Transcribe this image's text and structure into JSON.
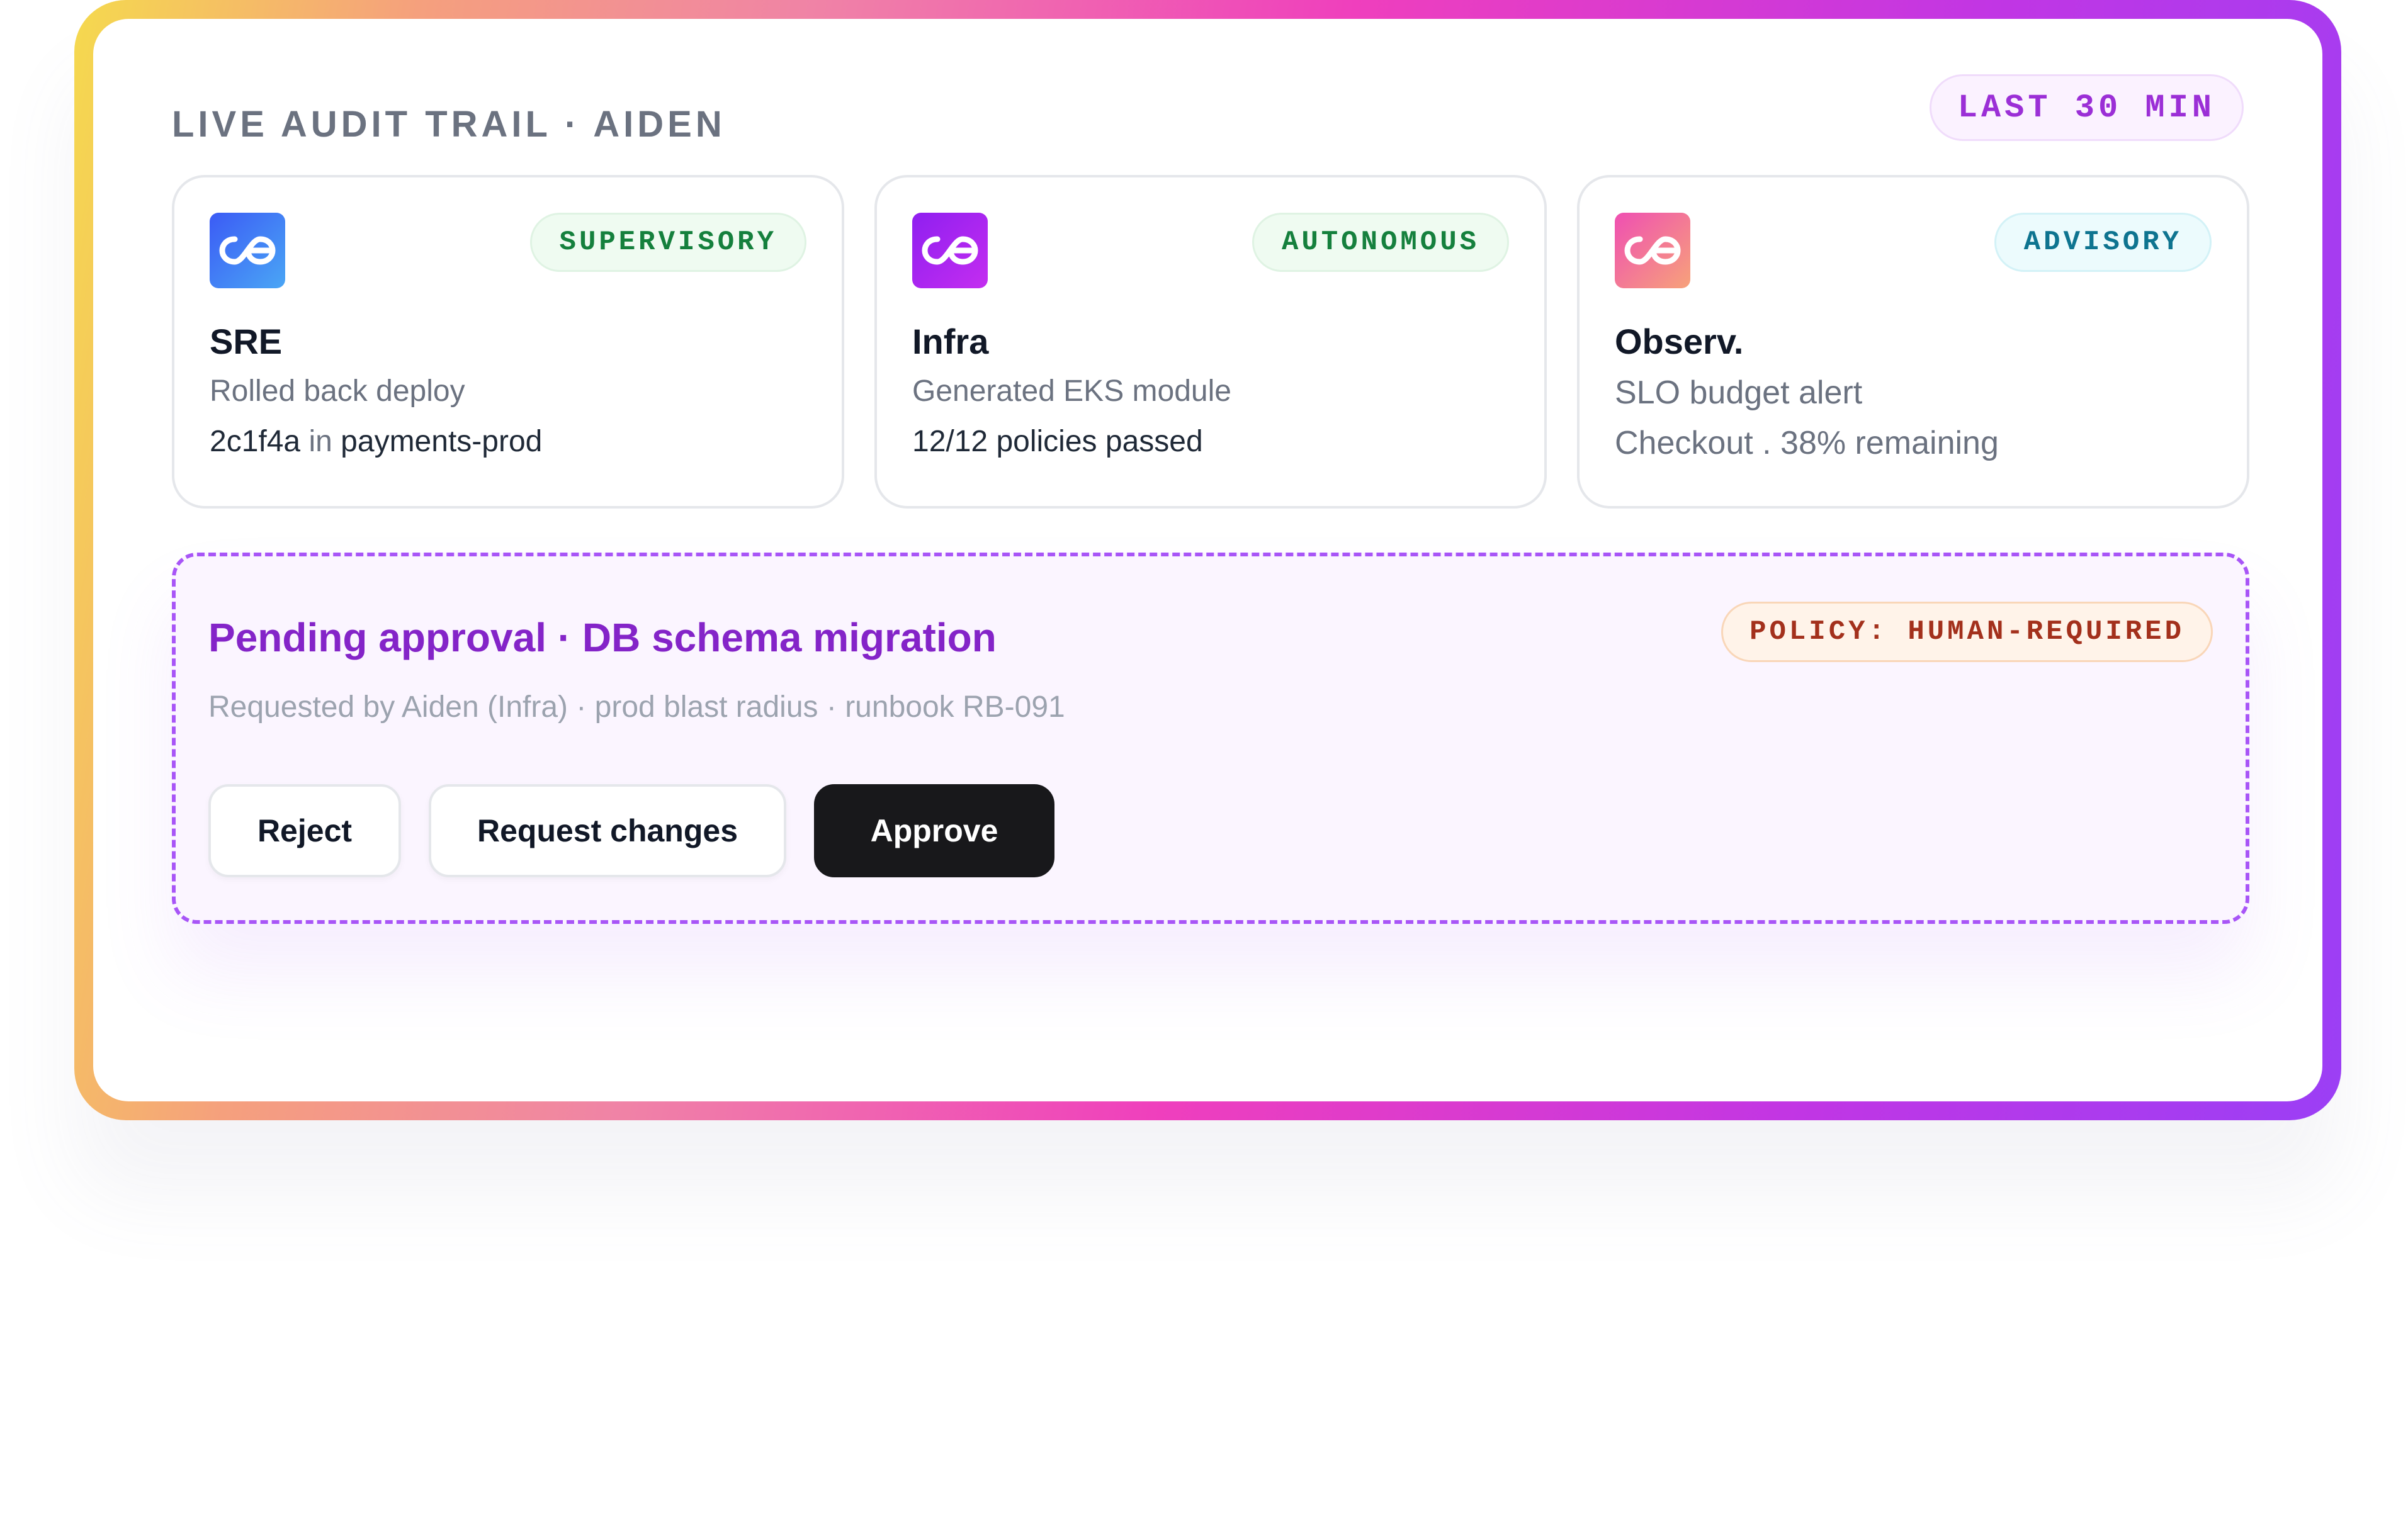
{
  "header": {
    "title": "LIVE AUDIT TRAIL · AIDEN",
    "time_badge": "LAST 30 MIN"
  },
  "agents": [
    {
      "icon": "agent-logo-icon",
      "mode": "SUPERVISORY",
      "name": "SRE",
      "line1": "Rolled back deploy",
      "line2_commit": "2c1f4a",
      "line2_in": "in",
      "line2_target": "payments-prod"
    },
    {
      "icon": "agent-logo-icon",
      "mode": "AUTONOMOUS",
      "name": "Infra",
      "line1": "Generated EKS module",
      "line2": "12/12 policies passed"
    },
    {
      "icon": "agent-logo-icon",
      "mode": "ADVISORY",
      "name": "Observ.",
      "line1": "SLO budget alert",
      "line2": "Checkout .  38% remaining"
    }
  ],
  "pending": {
    "title": "Pending approval · DB schema migration",
    "policy_badge": "POLICY: HUMAN-REQUIRED",
    "meta": "Requested by Aiden (Infra) ·  prod blast radius ·  runbook RB-091",
    "actions": {
      "reject": "Reject",
      "request_changes": "Request changes",
      "approve": "Approve"
    }
  },
  "colors": {
    "accent_purple": "#8424c8",
    "supervisory_green": "#15803d",
    "advisory_cyan": "#0e7490",
    "policy_red": "#a3301c",
    "approve_dark": "#18181b"
  }
}
